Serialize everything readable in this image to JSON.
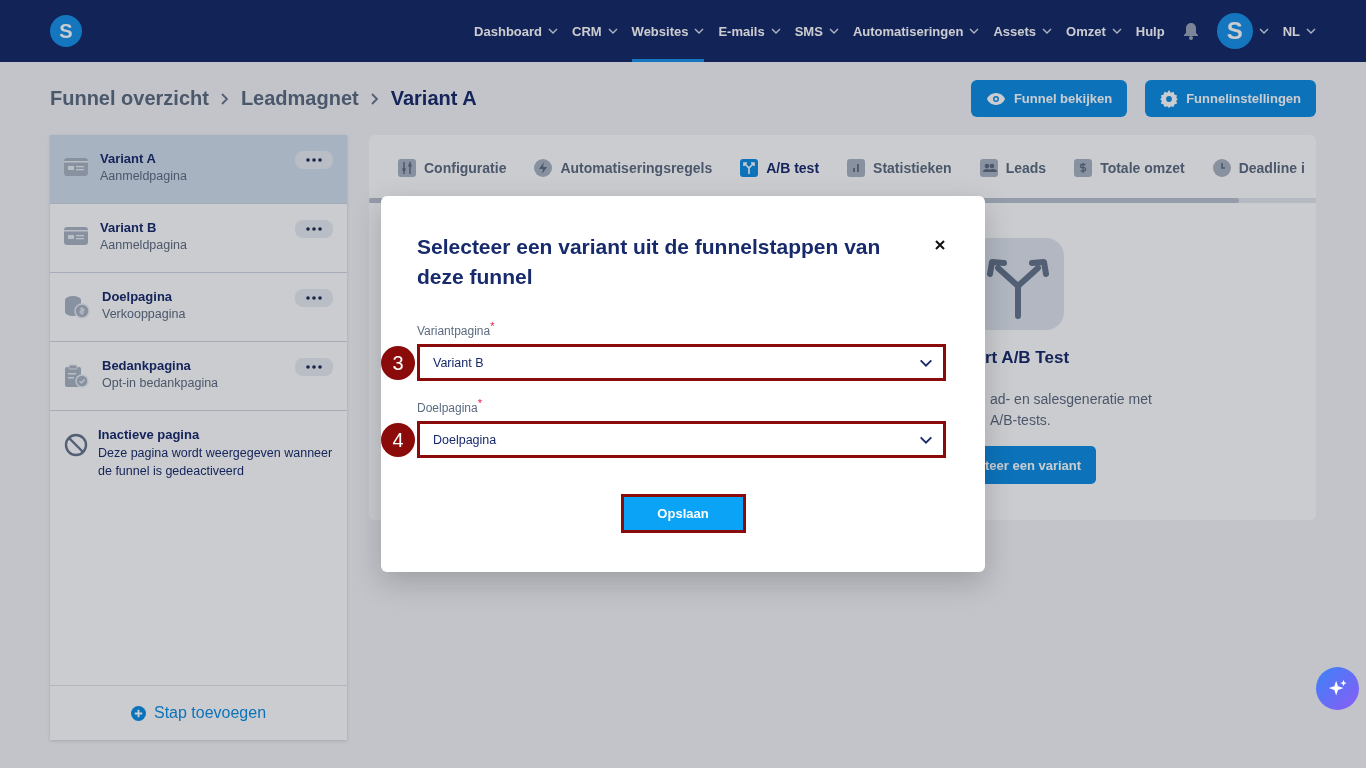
{
  "nav": {
    "logo": "S",
    "items": [
      {
        "label": "Dashboard",
        "dropdown": true,
        "selected": false
      },
      {
        "label": "CRM",
        "dropdown": true,
        "selected": false
      },
      {
        "label": "Websites",
        "dropdown": true,
        "selected": true
      },
      {
        "label": "E-mails",
        "dropdown": true,
        "selected": false
      },
      {
        "label": "SMS",
        "dropdown": true,
        "selected": false
      },
      {
        "label": "Automatiseringen",
        "dropdown": true,
        "selected": false
      },
      {
        "label": "Assets",
        "dropdown": true,
        "selected": false
      },
      {
        "label": "Omzet",
        "dropdown": true,
        "selected": false
      },
      {
        "label": "Hulp",
        "dropdown": false,
        "selected": false
      }
    ],
    "avatar": "S",
    "language": "NL"
  },
  "breadcrumb": [
    {
      "label": "Funnel overzicht",
      "current": false
    },
    {
      "label": "Leadmagnet",
      "current": false
    },
    {
      "label": "Variant A",
      "current": true
    }
  ],
  "header_buttons": [
    {
      "label": "Funnel bekijken"
    },
    {
      "label": "Funnelinstellingen"
    }
  ],
  "sidebar": {
    "items": [
      {
        "kind": "page",
        "title": "Variant A",
        "subtitle": "Aanmeldpagina",
        "selected": true
      },
      {
        "kind": "page",
        "title": "Variant B",
        "subtitle": "Aanmeldpagina",
        "selected": false
      },
      {
        "kind": "page",
        "title": "Doelpagina",
        "subtitle": "Verkooppagina",
        "selected": false
      },
      {
        "kind": "page",
        "title": "Bedankpagina",
        "subtitle": "Opt-in bedankpagina",
        "selected": false
      },
      {
        "kind": "inactive",
        "title": "Inactieve pagina",
        "subtitle": "Deze pagina wordt weergegeven wanneer de funnel is gedeactiveerd",
        "selected": false
      }
    ],
    "add_button": "Stap toevoegen"
  },
  "tabs": [
    {
      "label": "Configuratie",
      "selected": false
    },
    {
      "label": "Automatiseringsregels",
      "selected": false
    },
    {
      "label": "A/B test",
      "selected": true
    },
    {
      "label": "Statistieken",
      "selected": false
    },
    {
      "label": "Leads",
      "selected": false
    },
    {
      "label": "Totale omzet",
      "selected": false
    },
    {
      "label": "Deadline i",
      "selected": false
    }
  ],
  "empty_state": {
    "title": "rt A/B Test",
    "description_lines": [
      "ad- en salesgeneratie met",
      "A/B-tests."
    ],
    "button": "teer een variant"
  },
  "modal": {
    "title": "Selecteer een variant uit de funnelstappen van deze funnel",
    "fields": [
      {
        "label": "Variantpagina",
        "required_mark": "*",
        "value": "Variant B",
        "step": "3",
        "highlighted": true
      },
      {
        "label": "Doelpagina",
        "required_mark": "*",
        "value": "Doelpagina",
        "step": "4",
        "highlighted": true
      }
    ],
    "save_button": {
      "label": "Opslaan",
      "highlighted": true
    }
  }
}
